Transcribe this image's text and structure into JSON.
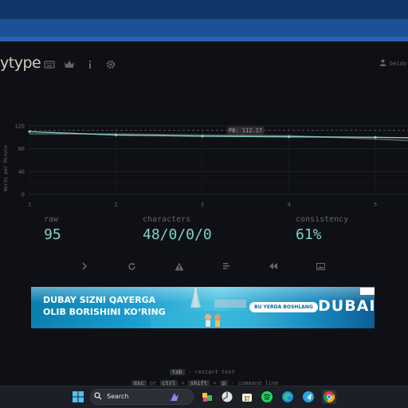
{
  "app": {
    "logo_text": "ytype",
    "nav": [
      {
        "name": "keyboard-icon"
      },
      {
        "name": "crown-icon"
      },
      {
        "name": "info-icon"
      },
      {
        "name": "gear-icon"
      }
    ],
    "user_label": "Geido"
  },
  "chart_data": {
    "type": "line",
    "ylabel": "Words per Minute",
    "ylim": [
      0,
      120
    ],
    "yticks": [
      "0",
      "40",
      "80",
      "120"
    ],
    "ytick_mid": [
      "20",
      "60",
      "100"
    ],
    "x": [
      1,
      2,
      3,
      4,
      5
    ],
    "xticks": [
      "1",
      "2",
      "3",
      "4",
      "5"
    ],
    "series": [
      {
        "color": "#7fd3c4",
        "values": [
          110,
          104,
          102,
          101,
          100,
          98
        ]
      },
      {
        "color": "#646669",
        "values": [
          106,
          106,
          104,
          103,
          97,
          90
        ]
      }
    ],
    "pb_label": "PB: 112.17",
    "pb_value": 112.17
  },
  "stats": {
    "raw_label": "raw",
    "raw_value": "95",
    "characters_label": "characters",
    "characters_value": "48/0/0/0",
    "consistency_label": "consistency",
    "consistency_value": "61%"
  },
  "actions": [
    {
      "name": "next-test-icon"
    },
    {
      "name": "restart-icon"
    },
    {
      "name": "warning-icon"
    },
    {
      "name": "words-history-icon"
    },
    {
      "name": "replay-icon"
    },
    {
      "name": "screenshot-icon"
    }
  ],
  "ad": {
    "headline_1": "DUBAY SIZNI QAYERGA",
    "headline_2": "OLIB BORISHINI KO‘RING",
    "cta": "BU YERDA BOSHLANG",
    "brand": "DUBAI"
  },
  "hints": {
    "key1": "tab",
    "text1": "- restart test",
    "key2a": "esc",
    "or": "or",
    "key2b": "ctrl",
    "plus1": "+",
    "key2c": "shift",
    "plus2": "+",
    "key2d": "p",
    "text2": "- command line"
  },
  "taskbar": {
    "search_placeholder": "Search",
    "icons": [
      "windows-start-icon",
      "copilot-icon",
      "files-icon",
      "widgets-icon",
      "store-icon",
      "spotify-icon",
      "edge-icon",
      "telegram-icon",
      "chrome-icon"
    ]
  }
}
